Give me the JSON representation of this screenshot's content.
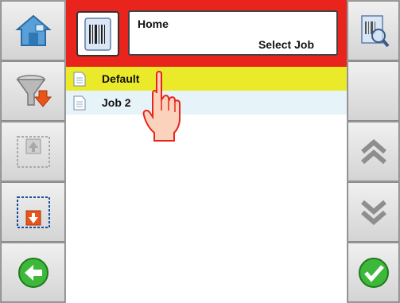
{
  "header": {
    "title": "Home",
    "subtitle": "Select Job"
  },
  "jobs": [
    {
      "label": "Default",
      "selected": true
    },
    {
      "label": "Job 2",
      "selected": false
    }
  ],
  "icons": {
    "left": [
      "home-icon",
      "filter-icon",
      "move-up-icon",
      "move-down-icon",
      "back-icon"
    ],
    "right": [
      "preview-icon",
      "blank",
      "scroll-up-icon",
      "scroll-down-icon",
      "confirm-icon"
    ],
    "header": "barcode-label-icon",
    "pointer": "hand-pointer-icon"
  },
  "colors": {
    "header_bg": "#e8241c",
    "selected_row": "#eaea2a",
    "alt_row": "#e6f3f9",
    "back_green": "#3db83a",
    "confirm_green": "#3db83a"
  }
}
